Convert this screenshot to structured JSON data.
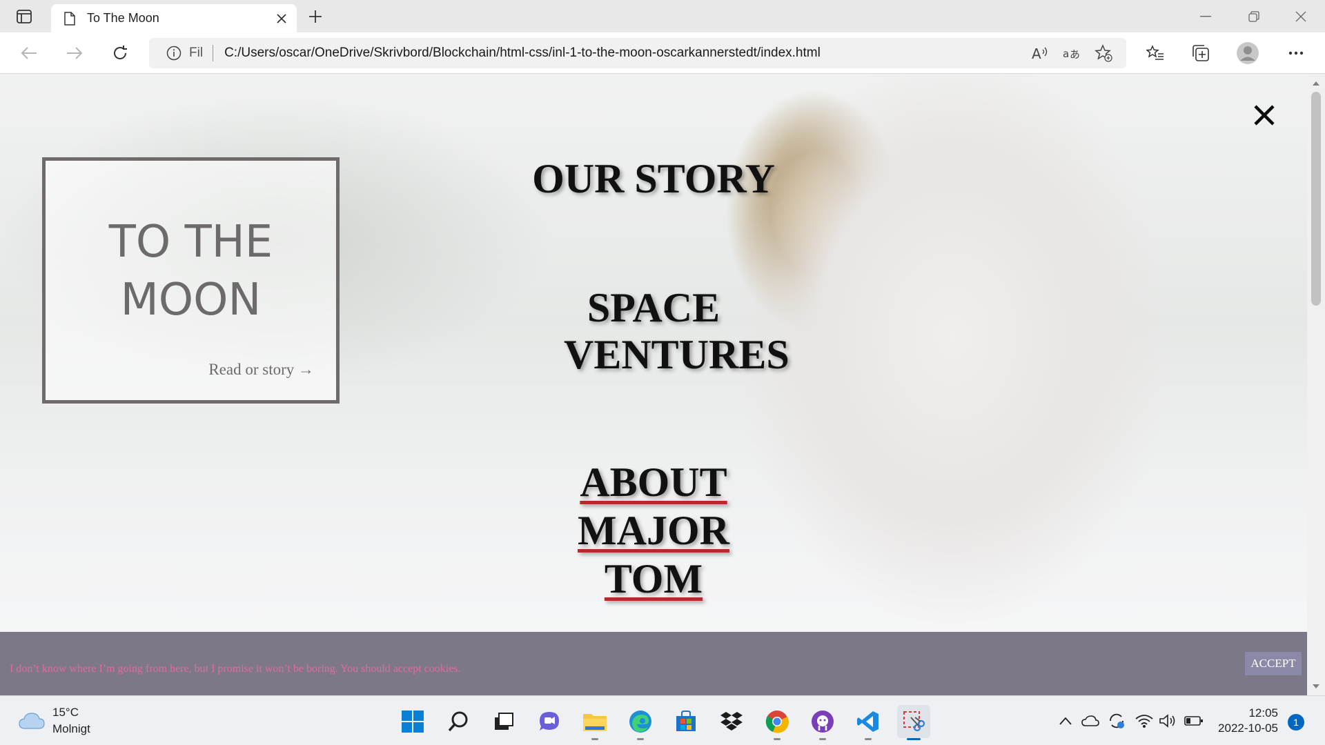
{
  "browser": {
    "tab_title": "To The Moon",
    "scheme_label": "Fil",
    "url": "C:/Users/oscar/OneDrive/Skrivbord/Blockchain/html-css/inl-1-to-the-moon-oscarkannerstedt/index.html",
    "omnibox_text_glyph_1": "Á",
    "omnibox_text_glyph_2": "aあ"
  },
  "page": {
    "brand_title": "TO THE MOON",
    "brand_link": "Read or story →",
    "nav": [
      {
        "label": "OUR STORY",
        "active": false
      },
      {
        "label": "SPACE VENTURES",
        "active": false
      },
      {
        "label": "ABOUT MAJOR TOM",
        "active": true
      }
    ],
    "cookie_text": "I don’t know where I’m going from here, but I promise it won’t be boring. You should accept cookies.",
    "cookie_button": "ACCEPT"
  },
  "colors": {
    "accent_underline": "#b52a2a",
    "cookie_bar": "#7d7887",
    "cookie_text": "#e36aa0",
    "accept_button": "#8b88a8"
  },
  "taskbar": {
    "weather_temp": "15°C",
    "weather_desc": "Molnigt",
    "apps": [
      "windows-start",
      "search",
      "task-view",
      "teams-chat",
      "file-explorer",
      "edge",
      "microsoft-store",
      "dropbox",
      "chrome",
      "github-desktop",
      "vscode",
      "snipping-tool"
    ],
    "clock_time": "12:05",
    "clock_date": "2022-10-05",
    "notification_count": "1"
  }
}
